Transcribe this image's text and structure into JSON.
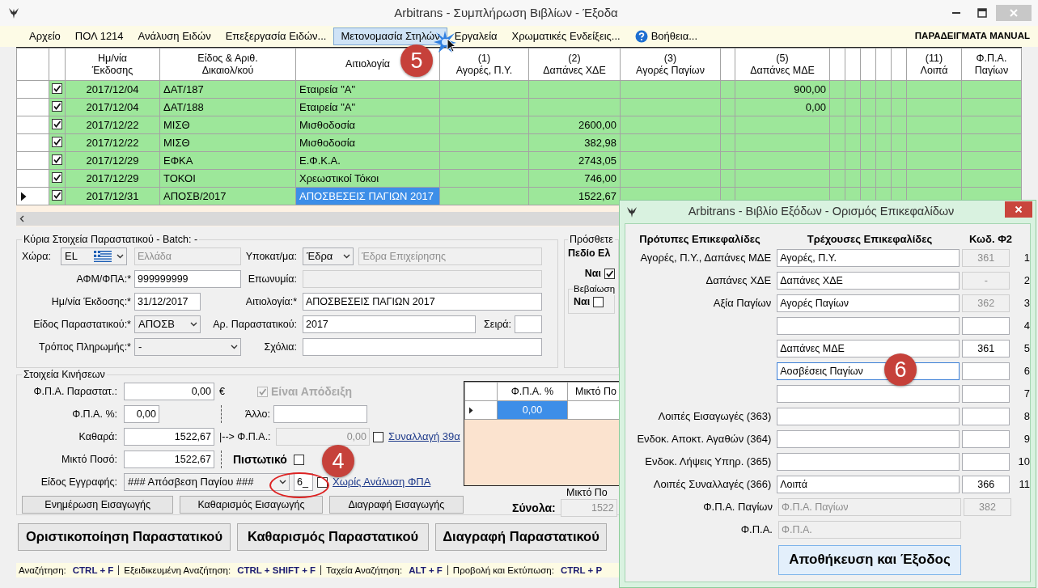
{
  "window": {
    "title": "Arbitrans - Συμπλήρωση Βιβλίων - Έξοδα"
  },
  "menu": {
    "items": [
      {
        "label": "Αρχείο",
        "kind": "text",
        "selected": false
      },
      {
        "label": "ΠΟΛ 1214",
        "kind": "text",
        "selected": false
      },
      {
        "label": "Ανάλυση Ειδών",
        "kind": "text",
        "selected": false
      },
      {
        "label": "Επεξεργασία Ειδών...",
        "kind": "text",
        "selected": false
      },
      {
        "label": "Μετονομασία Στηλών",
        "kind": "text",
        "selected": true
      },
      {
        "label": "Εργαλεία",
        "kind": "text",
        "selected": false
      },
      {
        "label": "Χρωματικές Ενδείξεις...",
        "kind": "text",
        "selected": false
      },
      {
        "label": "Βοήθεια...",
        "kind": "help",
        "selected": false
      }
    ],
    "right_label": "ΠΑΡΑΔΕΙΓΜΑΤΑ MANUAL"
  },
  "grid": {
    "columns": [
      {
        "lines": [
          "Ημ/νία",
          "Έκδοσης"
        ]
      },
      {
        "lines": [
          "Είδος & Αριθ.",
          "Δικαιολ/κού"
        ]
      },
      {
        "lines": [
          "Αιτιολογία"
        ]
      },
      {
        "lines": [
          "(1)",
          "Αγορές, Π.Υ."
        ]
      },
      {
        "lines": [
          "(2)",
          "Δαπάνες ΧΔΕ"
        ]
      },
      {
        "lines": [
          "(3)",
          "Αγορές Παγίων"
        ]
      },
      {
        "lines": [
          "(5)",
          "Δαπάνες ΜΔΕ"
        ]
      },
      {
        "lines": [
          "(11)",
          "Λοιπά"
        ]
      },
      {
        "lines": [
          "Φ.Π.Α.",
          "Παγίων"
        ]
      }
    ],
    "rows": [
      {
        "checked": true,
        "current": false,
        "selected": false,
        "date": "2017/12/04",
        "document": "ΔΑΤ/187",
        "reason": "Εταιρεία \"Α\"",
        "expenses_mde": "900,00"
      },
      {
        "checked": true,
        "current": false,
        "selected": false,
        "date": "2017/12/04",
        "document": "ΔΑΤ/188",
        "reason": "Εταιρεία \"Α\"",
        "expenses_mde": "0,00"
      },
      {
        "checked": true,
        "current": false,
        "selected": false,
        "date": "2017/12/22",
        "document": "ΜΙΣΘ",
        "reason": "Μισθοδοσία",
        "expenses_xde": "2600,00"
      },
      {
        "checked": true,
        "current": false,
        "selected": false,
        "date": "2017/12/22",
        "document": "ΜΙΣΘ",
        "reason": "Μισθοδοσία",
        "expenses_xde": "382,98"
      },
      {
        "checked": true,
        "current": false,
        "selected": false,
        "date": "2017/12/29",
        "document": "ΕΦΚΑ",
        "reason": "Ε.Φ.Κ.Α.",
        "expenses_xde": "2743,05"
      },
      {
        "checked": true,
        "current": false,
        "selected": false,
        "date": "2017/12/29",
        "document": "ΤΟΚΟΙ",
        "reason": "Χρεωστικοί Τόκοι",
        "expenses_xde": "746,00"
      },
      {
        "checked": true,
        "current": true,
        "selected": true,
        "date": "2017/12/31",
        "document": "ΑΠΟΣΒ/2017",
        "reason": "ΑΠΟΣΒΕΣΕΙΣ ΠΑΓΙΩΝ 2017",
        "expenses_xde": "1522,67"
      }
    ],
    "callout": "5"
  },
  "document": {
    "legend": "Κύρια Στοιχεία Παραστατικού - Batch: -",
    "country_label": "Χώρα:",
    "country_code": "EL",
    "country_name": "Ελλάδα",
    "branch_label": "Υποκατ/μα:",
    "branch": "Έδρα",
    "branch_name": "Έδρα Επιχείρησης",
    "vat_label": "ΑΦΜ/ΦΠΑ:*",
    "vat": "999999999",
    "name_label": "Επωνυμία:",
    "date_label": "Ημ/νία Έκδοσης:*",
    "date": "31/12/2017",
    "reason_label": "Αιτιολογία:*",
    "reason": "ΑΠΟΣΒΕΣΕΙΣ ΠΑΓΙΩΝ 2017",
    "type_label": "Είδος Παραστατικού:*",
    "type": "ΑΠΟΣΒ",
    "number_label": "Αρ. Παραστατικού:",
    "number": "2017",
    "series_label": "Σειρά:",
    "payment_label": "Τρόπος Πληρωμής:*",
    "payment": "-",
    "comments_label": "Σχόλια:"
  },
  "extra": {
    "legend": "Πρόσθετε",
    "field_label": "Πεδίο Ελ",
    "yes_label": "Ναι",
    "yes_checked": true,
    "confirm_legend": "Βεβαίωση",
    "confirm_yes_label": "Ναι",
    "confirm_checked": false
  },
  "movements": {
    "legend": "Στοιχεία Κινήσεων",
    "vat_doc_label": "Φ.Π.Α. Παραστατ.:",
    "vat_doc": "0,00",
    "currency": "€",
    "receipt_label": "Είναι Απόδειξη",
    "receipt_checked": true,
    "receipt_disabled": true,
    "vat_pct_label": "Φ.Π.Α. %:",
    "vat_pct": "0,00",
    "other_label": "Άλλο:",
    "net_label": "Καθαρά:",
    "net": "1522,67",
    "vat_arrow_label": "|--> Φ.Π.Α.:",
    "vat_amount": "0,00",
    "art39_checked": false,
    "art39_link": "Συναλλαγή 39α",
    "gross_label": "Μικτό Ποσό:",
    "gross": "1522,67",
    "credit_label": "Πιστωτικό",
    "credit_checked": false,
    "entry_label": "Είδος Εγγραφής:",
    "entry_type": "### Απόσβεση Παγίου ###",
    "entry_code": "6_",
    "no_vat_checked": false,
    "no_vat_link": "Χωρίς Ανάλυση ΦΠΑ",
    "buttons": [
      "Ενημέρωση Εισαγωγής",
      "Καθαρισμός Εισαγωγής",
      "Διαγραφή Εισαγωγής"
    ],
    "vat_grid": {
      "columns": [
        "Φ.Π.Α. %",
        "Μικτό Πο"
      ],
      "rows": [
        {
          "current": true,
          "selected": true,
          "vat_pct": "0,00"
        }
      ]
    },
    "gross_total_label": "Μικτό Πο",
    "totals_label": "Σύνολα:",
    "gross_total": "1522",
    "callout": "4"
  },
  "actions": [
    "Οριστικοποίηση Παραστατικού",
    "Καθαρισμός Παραστατικού",
    "Διαγραφή Παραστατικού"
  ],
  "status_bar": [
    {
      "label": "Αναζήτηση:",
      "keys": "CTRL + F"
    },
    {
      "label": "Εξειδικευμένη Αναζήτηση:",
      "keys": "CTRL + SHIFT + F"
    },
    {
      "label": "Ταχεία Αναζήτηση:",
      "keys": "ALT + F"
    },
    {
      "label": "Προβολή και Εκτύπωση:",
      "keys": "CTRL + P"
    }
  ],
  "dialog": {
    "title": "Arbitrans - Βιβλίο Εξόδων - Ορισμός Επικεφαλίδων",
    "headers": [
      "Πρότυπες Επικεφαλίδες",
      "Τρέχουσες Επικεφαλίδες",
      "Κωδ. Φ2"
    ],
    "rows": [
      {
        "kind": "coded",
        "standard": "Αγορές, Π.Υ., Δαπάνες ΜΔΕ",
        "current": "Αγορές, Π.Υ.",
        "code": "361",
        "code_disabled": true,
        "disabled": false,
        "focused": false,
        "number": "1"
      },
      {
        "kind": "coded",
        "standard": "Δαπάνες ΧΔΕ",
        "current": "Δαπάνες ΧΔΕ",
        "code": "-",
        "code_disabled": true,
        "disabled": false,
        "focused": false,
        "number": "2"
      },
      {
        "kind": "coded",
        "standard": "Αξία Παγίων",
        "current": "Αγορές Παγίων",
        "code": "362",
        "code_disabled": true,
        "disabled": false,
        "focused": false,
        "number": "3"
      },
      {
        "kind": "coded",
        "code_disabled": false,
        "disabled": false,
        "focused": false,
        "number": "4"
      },
      {
        "kind": "coded",
        "current": "Δαπάνες ΜΔΕ",
        "code": "361",
        "code_disabled": false,
        "disabled": false,
        "focused": false,
        "number": "5"
      },
      {
        "kind": "coded",
        "current": "Αοσβέσεις Παγίων",
        "code_disabled": false,
        "disabled": false,
        "focused": true,
        "number": "6"
      },
      {
        "kind": "coded",
        "code_disabled": false,
        "disabled": false,
        "focused": false,
        "number": "7"
      },
      {
        "kind": "coded",
        "standard": "Λοιπές Εισαγωγές (363)",
        "code_disabled": false,
        "disabled": false,
        "focused": false,
        "number": "8"
      },
      {
        "kind": "coded",
        "standard": "Ενδοκ. Αποκτ. Αγαθών (364)",
        "code_disabled": false,
        "disabled": false,
        "focused": false,
        "number": "9"
      },
      {
        "kind": "coded",
        "standard": "Ενδοκ. Λήψεις Υπηρ. (365)",
        "code_disabled": false,
        "disabled": false,
        "focused": false,
        "number": "10"
      },
      {
        "kind": "coded",
        "standard": "Λοιπές Συναλλαγές (366)",
        "current": "Λοιπά",
        "code": "366",
        "code_disabled": false,
        "disabled": false,
        "focused": false,
        "number": "11"
      },
      {
        "kind": "coded",
        "standard": "Φ.Π.Α. Παγίων",
        "current": "Φ.Π.Α. Παγίων",
        "code": "382",
        "code_disabled": true,
        "disabled": true,
        "focused": false
      },
      {
        "kind": "uncoded",
        "standard": "Φ.Π.Α.",
        "current": "Φ.Π.Α.",
        "disabled": true,
        "focused": false
      }
    ],
    "save_button": "Αποθήκευση και Έξοδος",
    "callout": "6"
  }
}
